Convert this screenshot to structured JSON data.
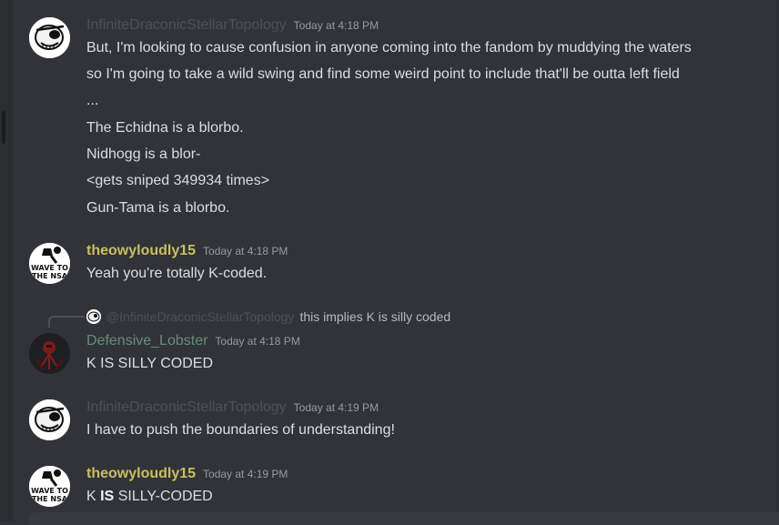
{
  "messages": [
    {
      "author": "InfiniteDraconicStellarTopology",
      "timestamp": "Today at 4:18 PM",
      "lines": [
        "But, I'm looking to cause confusion in anyone coming into the fandom by muddying the waters",
        "so I'm going to take a wild swing and find some weird point to include that'll be outta left field",
        "...",
        "The Echidna is a blorbo.",
        "Nidhogg is a blor-",
        "<gets sniped 349934 times>",
        "Gun-Tama is a blorbo."
      ]
    },
    {
      "author": "theowyloudly15",
      "avatar_text": [
        "WAVE TO",
        "THE NSA"
      ],
      "timestamp": "Today at 4:18 PM",
      "lines": [
        "Yeah you're totally K-coded."
      ]
    },
    {
      "reply_to": {
        "mention": "@InfiniteDraconicStellarTopology",
        "text": "this implies K is silly coded"
      },
      "author": "Defensive_Lobster",
      "timestamp": "Today at 4:18 PM",
      "lines": [
        "K IS SILLY CODED"
      ]
    },
    {
      "author": "InfiniteDraconicStellarTopology",
      "timestamp": "Today at 4:19 PM",
      "lines": [
        "I have to push the boundaries of understanding!"
      ]
    },
    {
      "author": "theowyloudly15",
      "avatar_text": [
        "WAVE TO",
        "THE NSA"
      ],
      "timestamp": "Today at 4:19 PM",
      "line_parts": [
        "K ",
        "IS",
        " SILLY-CODED"
      ]
    }
  ],
  "composer": {
    "partial_text": ""
  },
  "colors": {
    "background": "#313338",
    "text": "#dbdee1",
    "timestamp": "#949ba4",
    "username_idst": "#4e5058",
    "username_theo": "#c8c05d",
    "username_lobster": "#6a8a7a"
  }
}
